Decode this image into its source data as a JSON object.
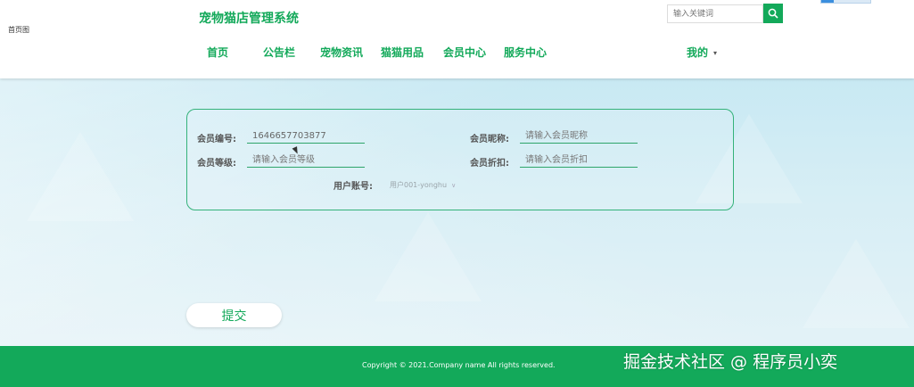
{
  "header": {
    "logo_text": "首页图",
    "site_title": "宠物猫店管理系统",
    "search": {
      "placeholder": "输入关键词"
    },
    "nav": [
      "首页",
      "公告栏",
      "宠物资讯",
      "猫猫用品",
      "会员中心",
      "服务中心"
    ],
    "my_menu": "我的"
  },
  "form": {
    "member_no": {
      "label": "会员编号:",
      "value": "1646657703877"
    },
    "member_nick": {
      "label": "会员昵称:",
      "placeholder": "请输入会员昵称"
    },
    "member_level": {
      "label": "会员等级:",
      "placeholder": "请输入会员等级"
    },
    "member_discount": {
      "label": "会员折扣:",
      "placeholder": "请输入会员折扣"
    },
    "user_account": {
      "label": "用户账号:",
      "selected": "用户001-yonghu"
    },
    "submit_label": "提交"
  },
  "footer": {
    "copyright": "Copyright © 2021.Company name All rights reserved.",
    "watermark": "掘金技术社区 @ 程序员小奕"
  },
  "colors": {
    "brand": "#13a95a",
    "search_button": "#13a95a",
    "footer_bg": "#13a95a"
  },
  "icons": {
    "search": "search-icon",
    "dropdown": "chevron-down-icon"
  }
}
